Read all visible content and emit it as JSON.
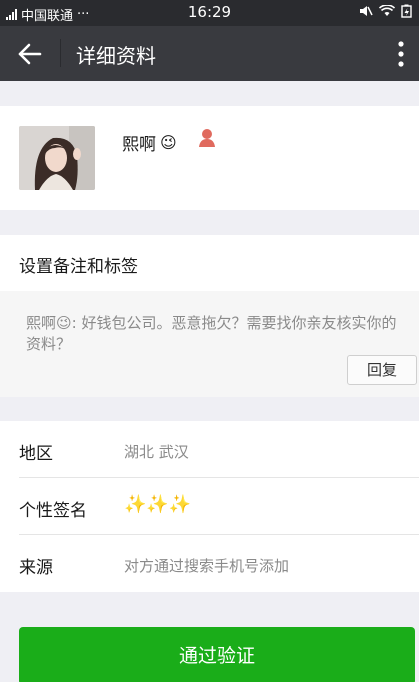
{
  "status_bar": {
    "carrier": "中国联通",
    "dots": "···",
    "time": "16:29"
  },
  "header": {
    "title": "详细资料"
  },
  "profile": {
    "name": "熙啊",
    "name_emoji": "😉"
  },
  "remark": {
    "label": "设置备注和标签"
  },
  "message": {
    "sender": "熙啊",
    "emoji": "😉",
    "text": ": 好钱包公司。恶意拖欠？需要找你亲友核实你的资料？",
    "reply_label": "回复"
  },
  "info": {
    "rows": [
      {
        "label": "地区",
        "value": "湖北  武汉"
      },
      {
        "label": "个性签名",
        "value": "✨✨✨"
      },
      {
        "label": "来源",
        "value": "对方通过搜索手机号添加"
      }
    ]
  },
  "actions": {
    "verify_label": "通过验证"
  },
  "colors": {
    "title_bar": "#393a3f",
    "status_bar": "#2a2b2f",
    "primary_green": "#1aad19",
    "gender_female": "#e06a5e"
  }
}
